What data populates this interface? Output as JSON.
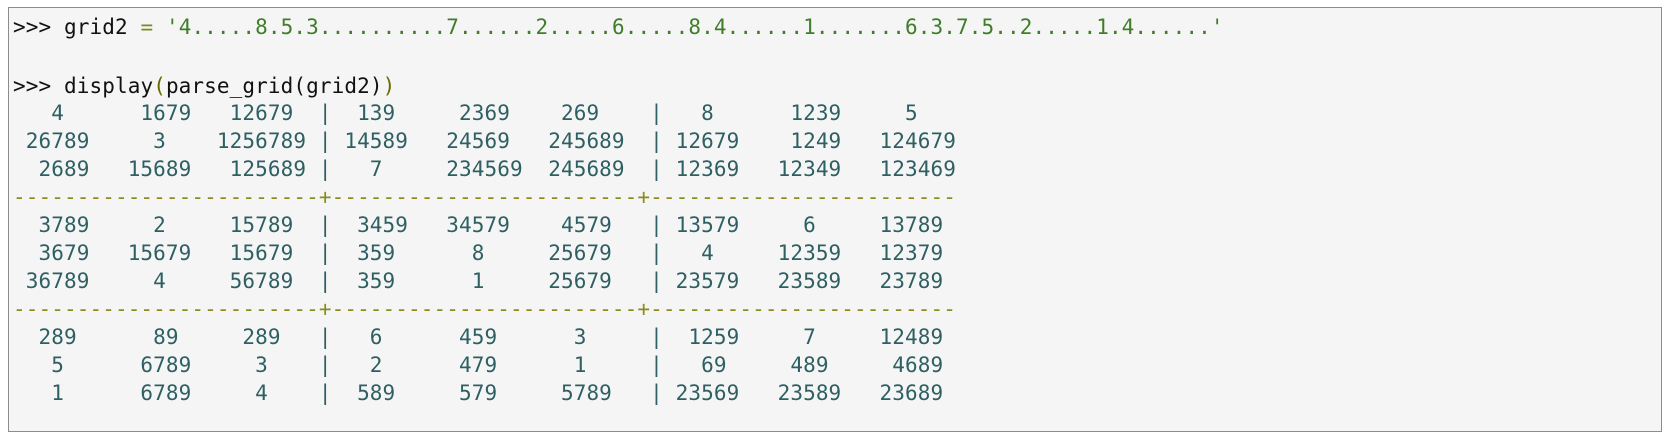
{
  "session": {
    "prompt": ">>>",
    "assignment": {
      "variable": "grid2",
      "operator": "=",
      "value": "'4.....8.5.3..........7......2.....6.....8.4......1.......6.3.7.5..2.....1.4......'"
    },
    "call": {
      "func": "display",
      "open": "(",
      "inner": "parse_grid(grid2)",
      "close": ")"
    }
  },
  "output": {
    "rows": [
      "   4      1679   12679  |  139     2369    269    |   8      1239     5",
      " 26789     3    1256789 | 14589   24569   245689  | 12679    1249   124679",
      "  2689   15689   125689 |   7     234569  245689  | 12369   12349   123469",
      "------------------------+------------------------+------------------------",
      "  3789     2     15789  |  3459   34579    4579   | 13579     6     13789",
      "  3679   15679   15679  |  359      8     25679   |   4     12359   12379",
      " 36789     4     56789  |  359      1     25679   | 23579   23589   23789",
      "------------------------+------------------------+------------------------",
      "  289      89     289   |   6      459      3     |  1259     7     12489",
      "   5      6789     3    |   2      479      1     |   69     489     4689",
      "   1      6789     4    |  589     579     5789   | 23569   23589   23689"
    ]
  }
}
